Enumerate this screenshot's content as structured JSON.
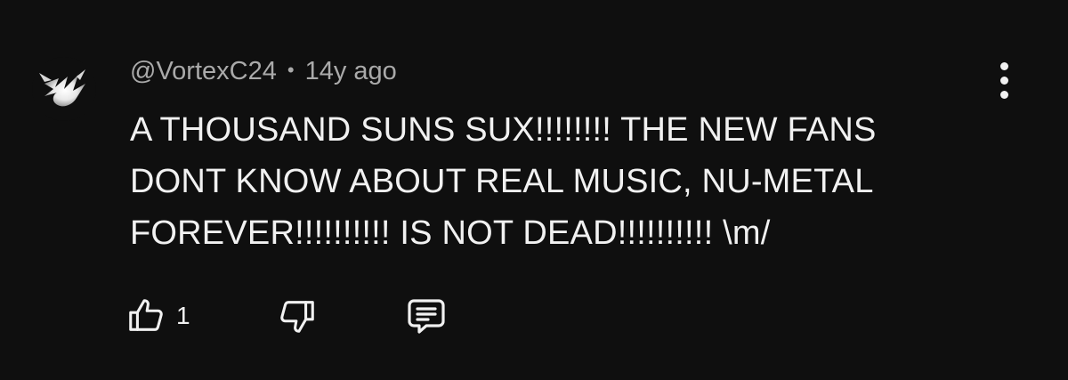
{
  "comment": {
    "author": "@VortexC24",
    "separator": "•",
    "age": "14y ago",
    "text_lines": [
      "A THOUSAND SUNS SUX!!!!!!!! THE NEW FANS",
      "DONT KNOW ABOUT REAL MUSIC, NU-METAL",
      "FOREVER!!!!!!!!!! IS NOT DEAD!!!!!!!!!! \\m/"
    ],
    "like_count": "1"
  },
  "icons": {
    "avatar": "bird-avatar-icon",
    "menu": "more-vertical-icon",
    "like": "thumbs-up-icon",
    "dislike": "thumbs-down-icon",
    "reply": "comment-reply-icon"
  },
  "colors": {
    "background": "#0f0f0f",
    "primary_text": "#f1f1f1",
    "secondary_text": "#aaaaaa"
  }
}
